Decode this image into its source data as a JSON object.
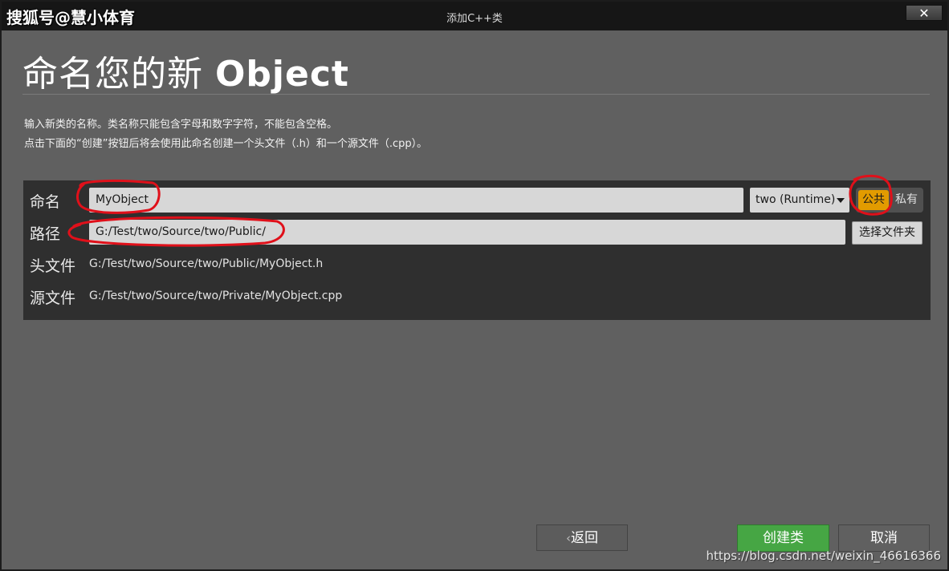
{
  "window": {
    "title": "添加C++类",
    "close_label": "✕"
  },
  "watermark_top": "搜狐号@慧小体育",
  "heading": {
    "prefix": "命名您的新",
    "class_name": "Object"
  },
  "description": {
    "line1": "输入新类的名称。类名称只能包含字母和数字字符，不能包含空格。",
    "line2": "点击下面的“创建”按钮后将会使用此命名创建一个头文件（.h）和一个源文件（.cpp）。"
  },
  "form": {
    "name_label": "命名",
    "name_value": "MyObject",
    "module_value": "two (Runtime)",
    "public_label": "公共",
    "private_label": "私有",
    "path_label": "路径",
    "path_value": "G:/Test/two/Source/two/Public/",
    "choose_folder_label": "选择文件夹",
    "header_label": "头文件",
    "header_value": "G:/Test/two/Source/two/Public/MyObject.h",
    "source_label": "源文件",
    "source_value": "G:/Test/two/Source/two/Private/MyObject.cpp"
  },
  "footer": {
    "back_label": "返回",
    "back_icon": "chevron-left-icon",
    "create_label": "创建类",
    "cancel_label": "取消"
  },
  "watermark_bottom": "https://blog.csdn.net/weixin_46616366",
  "colors": {
    "window_bg": "#606060",
    "panel_bg": "#2f2f2f",
    "accent_public": "#e29b00",
    "create_button": "#46a644",
    "annotation_red": "#e0101a"
  }
}
